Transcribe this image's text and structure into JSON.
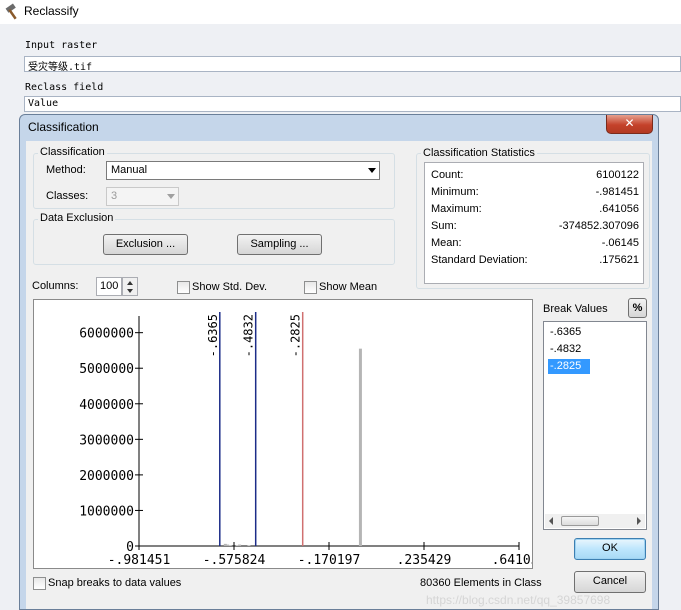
{
  "parent": {
    "title": "Reclassify",
    "input_raster_label": "Input raster",
    "input_raster_value": "受灾等级.tif",
    "reclass_field_label": "Reclass field",
    "reclass_field_value": "Value"
  },
  "dialog": {
    "title": "Classification",
    "close_glyph": "✕"
  },
  "classification": {
    "group_label": "Classification",
    "method_label": "Method:",
    "method_value": "Manual",
    "classes_label": "Classes:",
    "classes_value": "3"
  },
  "data_exclusion": {
    "group_label": "Data Exclusion",
    "exclusion_button": "Exclusion ...",
    "sampling_button": "Sampling ..."
  },
  "statistics": {
    "group_label": "Classification Statistics",
    "rows": [
      {
        "label": "Count:",
        "value": "6100122"
      },
      {
        "label": "Minimum:",
        "value": "-.981451"
      },
      {
        "label": "Maximum:",
        "value": ".641056"
      },
      {
        "label": "Sum:",
        "value": "-374852.307096"
      },
      {
        "label": "Mean:",
        "value": "-.06145"
      },
      {
        "label": "Standard Deviation:",
        "value": ".175621"
      }
    ]
  },
  "columns": {
    "label": "Columns:",
    "value": "100"
  },
  "options": {
    "show_std_dev": "Show Std. Dev.",
    "show_mean": "Show Mean",
    "snap_breaks": "Snap breaks to data values"
  },
  "break_values": {
    "label": "Break Values",
    "percent_button": "%",
    "items": [
      "-.6365",
      "-.4832",
      "-.2825"
    ],
    "selected_index": 2
  },
  "chart_data": {
    "type": "bar",
    "x_tick_labels": [
      "-.981451",
      "-.575824",
      "-.170197",
      ".235429",
      ".641056"
    ],
    "y_tick_labels": [
      "0",
      "1000000",
      "2000000",
      "3000000",
      "4000000",
      "5000000",
      "6000000"
    ],
    "xlim": [
      -0.981451,
      0.641056
    ],
    "ylim": [
      0,
      6300000
    ],
    "bars": [
      {
        "x": -0.613,
        "y": 60000
      },
      {
        "x": -0.603,
        "y": 40000
      },
      {
        "x": -0.592,
        "y": 20000
      },
      {
        "x": -0.562,
        "y": 20000
      },
      {
        "x": -0.552,
        "y": 40000
      },
      {
        "x": -0.512,
        "y": 20000
      },
      {
        "x": -0.036,
        "y": 5550000
      }
    ],
    "break_lines": [
      {
        "value": -0.6365,
        "label": "-.6365",
        "color": "#1c2c88"
      },
      {
        "value": -0.4832,
        "label": "-.4832",
        "color": "#1c2c88"
      },
      {
        "value": -0.2825,
        "label": "-.2825",
        "color": "#d07070"
      }
    ],
    "bar_color": "#b5b5b5"
  },
  "footer": {
    "elements_in_class": "80360 Elements in Class",
    "ok_button": "OK",
    "cancel_button": "Cancel"
  },
  "watermark": "https://blog.csdn.net/qq_39857698"
}
